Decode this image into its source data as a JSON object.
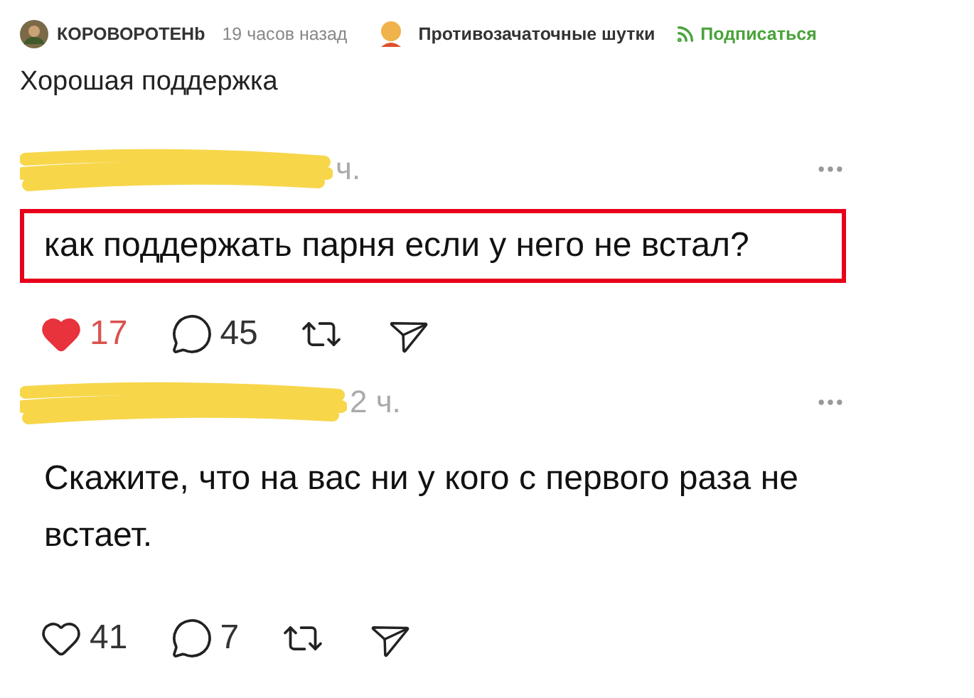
{
  "header": {
    "author": "КОРОВОРОТЕНb",
    "time": "19 часов назад",
    "community": "Противозачаточные шутки",
    "subscribe": "Подписаться"
  },
  "title": "Хорошая поддержка",
  "posts": [
    {
      "time": "ч.",
      "text": "как поддержать парня если у него не встал?",
      "highlighted": true,
      "liked": true,
      "likes": "17",
      "replies": "45"
    },
    {
      "time": "2 ч.",
      "text": "Скажите, что на вас ни у кого с первого раза не встает.",
      "highlighted": false,
      "liked": false,
      "likes": "41",
      "replies": "7"
    }
  ]
}
